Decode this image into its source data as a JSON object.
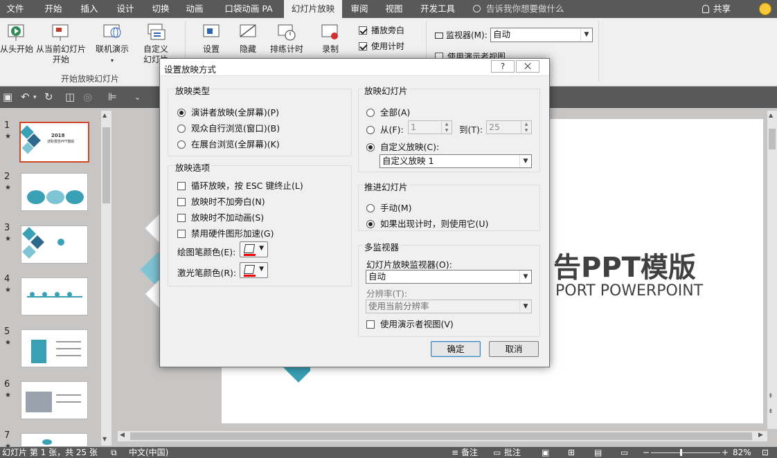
{
  "tabs": [
    "文件",
    "开始",
    "插入",
    "设计",
    "切换",
    "动画",
    "口袋动画 PA",
    "幻灯片放映",
    "审阅",
    "视图",
    "开发工具"
  ],
  "tell_me": "告诉我你想要做什么",
  "share": "共享",
  "ribbon": {
    "from_beginning": "从头开始",
    "from_current_1": "从当前幻灯片",
    "from_current_2": "开始",
    "online": "联机演示",
    "custom_1": "自定义",
    "custom_2": "幻灯片",
    "setup": "设置",
    "hide": "隐藏",
    "rehearse": "排练计时",
    "record": "录制",
    "play_narration": "播放旁白",
    "use_timings": "使用计时",
    "monitor_label": "监视器(M):",
    "monitor_value": "自动",
    "presenter_view": "使用演示者视图",
    "group_start": "开始放映幻灯片"
  },
  "thumbnails": [
    {
      "num": "1",
      "star": "★"
    },
    {
      "num": "2",
      "star": "★"
    },
    {
      "num": "3",
      "star": "★"
    },
    {
      "num": "4",
      "star": "★"
    },
    {
      "num": "5",
      "star": "★"
    },
    {
      "num": "6",
      "star": "★"
    },
    {
      "num": "7",
      "star": "★"
    }
  ],
  "thumb_text": {
    "t1_year": "2018",
    "t1_title": "述职报告PPT模版"
  },
  "slide": {
    "title": "告PPT模版",
    "subtitle": "PORT POWERPOINT"
  },
  "dialog": {
    "title": "设置放映方式",
    "help": "?",
    "close": "⨉",
    "show_type_legend": "放映类型",
    "show_type_options": [
      "演讲者放映(全屏幕)(P)",
      "观众自行浏览(窗口)(B)",
      "在展台浏览(全屏幕)(K)"
    ],
    "show_options_legend": "放映选项",
    "show_options": [
      "循环放映，按 ESC 键终止(L)",
      "放映时不加旁白(N)",
      "放映时不加动画(S)",
      "禁用硬件图形加速(G)"
    ],
    "pen_color_label": "绘图笔颜色(E):",
    "laser_color_label": "激光笔颜色(R):",
    "slides_legend": "放映幻灯片",
    "all": "全部(A)",
    "from": "从(F):",
    "from_value": "1",
    "to": "到(T):",
    "to_value": "25",
    "custom_show": "自定义放映(C):",
    "custom_show_value": "自定义放映 1",
    "advance_legend": "推进幻灯片",
    "manual": "手动(M)",
    "use_timings": "如果出现计时，则使用它(U)",
    "multi_legend": "多监视器",
    "monitor_label": "幻灯片放映监视器(O):",
    "monitor_value": "自动",
    "resolution_label": "分辨率(T):",
    "resolution_value": "使用当前分辨率",
    "presenter_view": "使用演示者视图(V)",
    "ok": "确定",
    "cancel": "取消"
  },
  "status": {
    "slide_info": "幻灯片 第 1 张，共 25 张",
    "language": "中文(中国)",
    "notes": "备注",
    "comments": "批注",
    "zoom": "82%"
  },
  "colors": {
    "tab_bg": "#595959",
    "accent": "#d24726",
    "thumb_teal": "#3aa0b5"
  }
}
